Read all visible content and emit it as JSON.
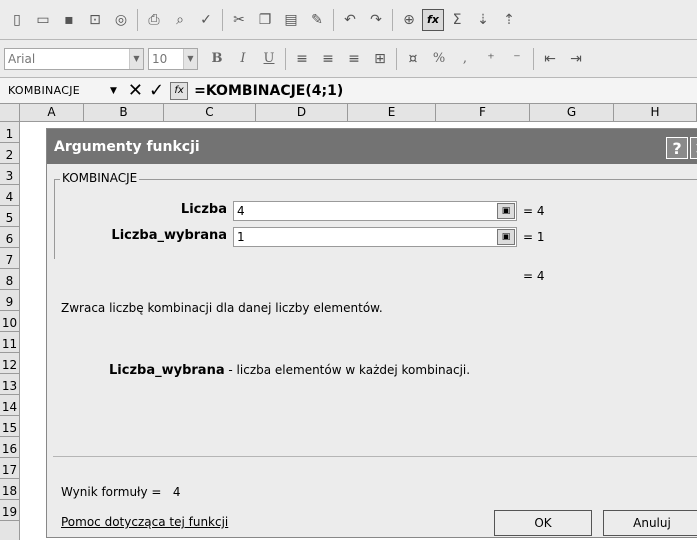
{
  "toolbar2": {
    "font_name": "Arial",
    "font_size": "10",
    "bold": "B",
    "italic": "I",
    "underline": "U",
    "percent": "%",
    "comma": ","
  },
  "formula_bar": {
    "name_box": "KOMBINACJE",
    "cancel": "✕",
    "enter": "✓",
    "fx": "fx",
    "formula": "=KOMBINACJE(4;1)"
  },
  "columns": [
    "A",
    "B",
    "C",
    "D",
    "E",
    "F",
    "G",
    "H"
  ],
  "rows": [
    "1",
    "2",
    "3",
    "4",
    "5",
    "6",
    "7",
    "8",
    "9",
    "10",
    "11",
    "12",
    "13",
    "14",
    "15",
    "16",
    "17",
    "18",
    "19"
  ],
  "dialog": {
    "title": "Argumenty funkcji",
    "help_btn": "?",
    "close_btn": "✕",
    "group_label": "KOMBINACJE",
    "args": [
      {
        "label": "Liczba",
        "value": "4",
        "result": "= 4"
      },
      {
        "label": "Liczba_wybrana",
        "value": "1",
        "result": "= 1"
      }
    ],
    "total_result": "= 4",
    "description": "Zwraca liczbę kombinacji dla danej liczby elementów.",
    "param_name": "Liczba_wybrana",
    "param_desc": " - liczba elementów w każdej kombinacji.",
    "formula_result_label": "Wynik formuły =",
    "formula_result_value": "4",
    "help_link": "Pomoc dotycząca tej funkcji",
    "ok": "OK",
    "cancel": "Anuluj"
  }
}
